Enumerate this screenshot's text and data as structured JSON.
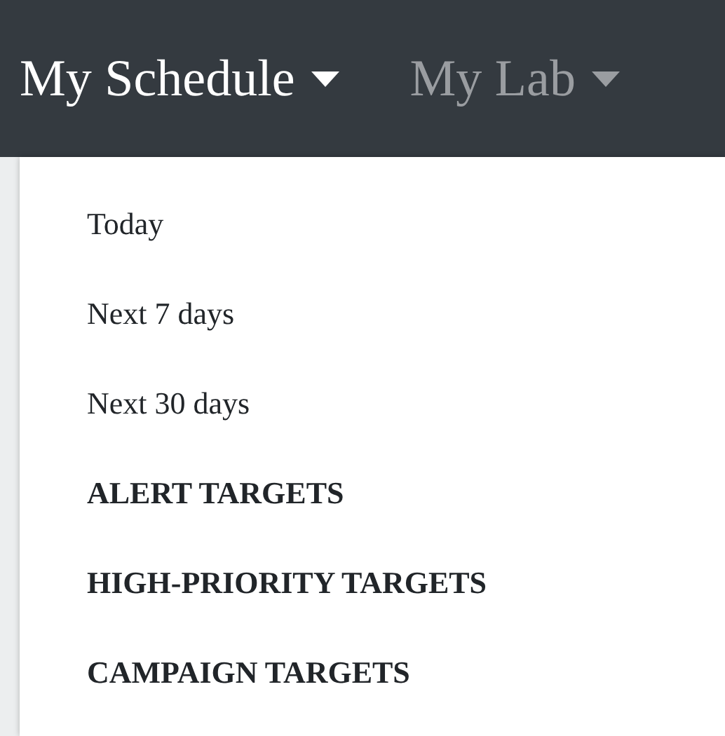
{
  "navbar": {
    "items": [
      {
        "label": "My Schedule",
        "selected": true
      },
      {
        "label": "My Lab",
        "selected": false
      }
    ]
  },
  "dropdown": {
    "items": [
      {
        "label": "Today",
        "kind": "link"
      },
      {
        "label": "Next 7 days",
        "kind": "link"
      },
      {
        "label": "Next 30 days",
        "kind": "link"
      },
      {
        "label": "ALERT TARGETS",
        "kind": "category"
      },
      {
        "label": "HIGH-PRIORITY TARGETS",
        "kind": "category"
      },
      {
        "label": "CAMPAIGN TARGETS",
        "kind": "category"
      }
    ]
  }
}
